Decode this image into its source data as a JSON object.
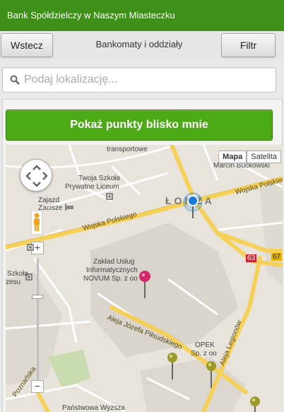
{
  "app": {
    "title": "Bank Spółdzielczy w Naszym Miasteczku"
  },
  "nav": {
    "back_label": "Wstecz",
    "title": "Bankomaty i oddziały",
    "filter_label": "Filtr"
  },
  "search": {
    "placeholder": "Podaj lokalizację..."
  },
  "cta": {
    "label": "Pokaż punkty blisko mnie"
  },
  "map": {
    "map_type_active": "Mapa",
    "map_type_other": "Satelita",
    "zoom_in": "+",
    "zoom_out": "−",
    "labels": {
      "transportowe": "transportowe",
      "marcin": "Marcin Bućkowski",
      "twoja_szkola": "Twoja Szkoła",
      "prywatne": "Prywatne Liceum",
      "zajazd": "Zajazd",
      "zacisze": "Zacisze",
      "city": "ŁOMŻA",
      "wojska1": "Wojska Polskiego",
      "wojska2": "Wojska Polskiego",
      "road63": "63",
      "road67": "67",
      "zaklad": "Zakład Usług",
      "informatycznych": "Informatycznych",
      "novum": "NOVUM Sp. z oo",
      "szkola": "Szkoła",
      "nesu": "zesu",
      "opek": "OPEK",
      "spzoo": "Sp. z oo",
      "aleja_pilsud": "Aleja Józefa Piłsudskiego",
      "aleja_leg": "Aleja Legionów",
      "poznanska": "Poznańska",
      "panstwowa": "Państwowa Wyższa"
    }
  },
  "colors": {
    "topbar": "#3f8f1b",
    "cta": "#4caa14",
    "marker_branch": "#d3286a",
    "marker_atm": "#9c9a2b",
    "location": "#1a7ad9"
  }
}
